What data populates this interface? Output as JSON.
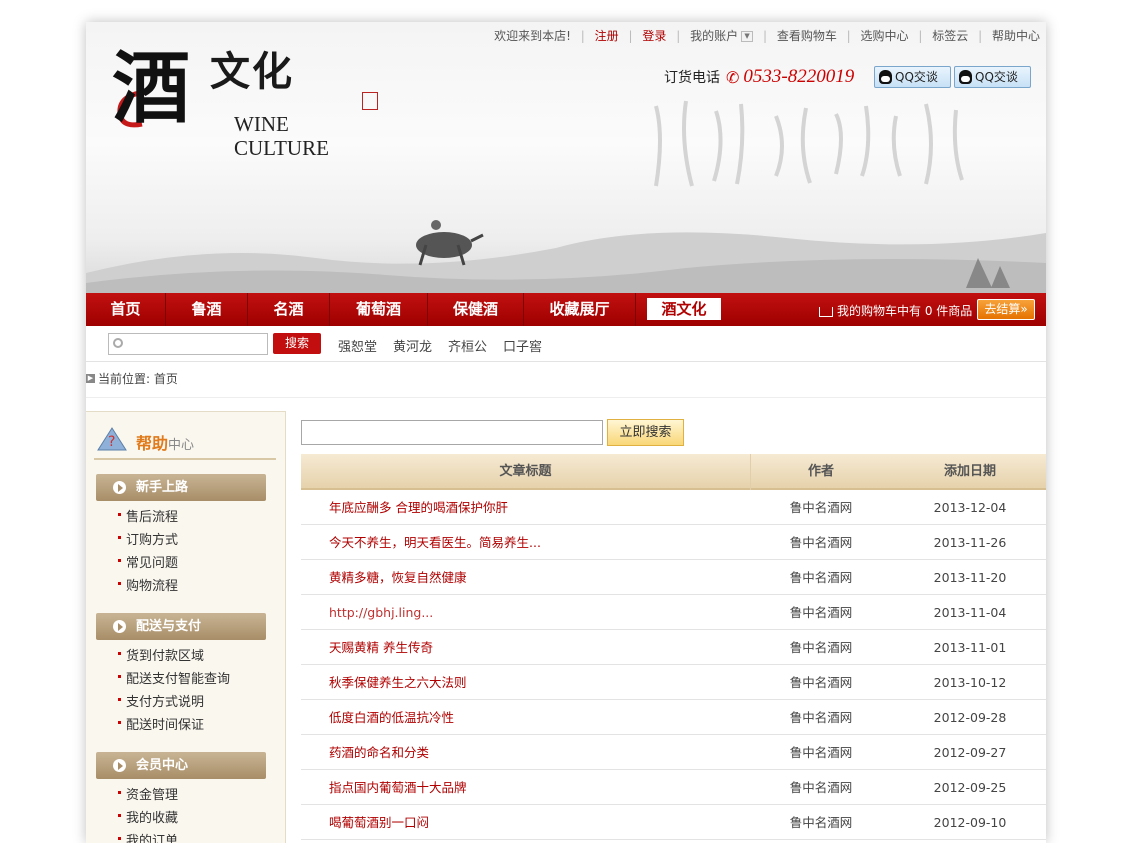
{
  "topbar": {
    "welcome": "欢迎来到本店!",
    "register": "注册",
    "login": "登录",
    "my_account": "我的账户",
    "view_cart": "查看购物车",
    "selection_center": "选购中心",
    "tag_cloud": "标签云",
    "help_center": "帮助中心"
  },
  "logo": {
    "main_char": "酒",
    "sub_chars": "文化",
    "english": "WINE CULTURE"
  },
  "phone": {
    "label": "订货电话",
    "number": "0533-8220019"
  },
  "qq_buttons": [
    "QQ交谈",
    "QQ交谈"
  ],
  "nav": {
    "items": [
      "首页",
      "鲁酒",
      "名酒",
      "葡萄酒",
      "保健酒",
      "收藏展厅",
      "酒文化"
    ],
    "active": "酒文化",
    "cart_text": "我的购物车中有 0 件商品",
    "checkout": "去结算»"
  },
  "search": {
    "button": "搜索",
    "keywords": [
      "强恕堂",
      "黄河龙",
      "齐桓公",
      "口子窖"
    ]
  },
  "breadcrumb": {
    "text": "当前位置: 首页"
  },
  "sidebar": {
    "title_main": "帮助",
    "title_sub": "中心",
    "sections": [
      {
        "title": "新手上路",
        "links": [
          "售后流程",
          "订购方式",
          "常见问题",
          "购物流程"
        ]
      },
      {
        "title": "配送与支付",
        "links": [
          "货到付款区域",
          "配送支付智能查询",
          "支付方式说明",
          "配送时间保证"
        ]
      },
      {
        "title": "会员中心",
        "links": [
          "资金管理",
          "我的收藏",
          "我的订单"
        ]
      }
    ]
  },
  "main": {
    "search_button": "立即搜索",
    "columns": [
      "文章标题",
      "作者",
      "添加日期"
    ],
    "articles": [
      {
        "title": "年底应酬多 合理的喝酒保护你肝",
        "author": "鲁中名酒网",
        "date": "2013-12-04"
      },
      {
        "title": "今天不养生，明天看医生。简易养生...",
        "author": "鲁中名酒网",
        "date": "2013-11-26"
      },
      {
        "title": "黄精多糖，恢复自然健康",
        "author": "鲁中名酒网",
        "date": "2013-11-20"
      },
      {
        "title": "http://gbhj.ling...",
        "author": "鲁中名酒网",
        "date": "2013-11-04"
      },
      {
        "title": "天赐黄精 养生传奇",
        "author": "鲁中名酒网",
        "date": "2013-11-01"
      },
      {
        "title": "秋季保健养生之六大法则",
        "author": "鲁中名酒网",
        "date": "2013-10-12"
      },
      {
        "title": "低度白酒的低温抗冷性",
        "author": "鲁中名酒网",
        "date": "2012-09-28"
      },
      {
        "title": "药酒的命名和分类",
        "author": "鲁中名酒网",
        "date": "2012-09-27"
      },
      {
        "title": "指点国内葡萄酒十大品牌",
        "author": "鲁中名酒网",
        "date": "2012-09-25"
      },
      {
        "title": "喝葡萄酒别一口闷",
        "author": "鲁中名酒网",
        "date": "2012-09-10"
      }
    ]
  },
  "colors": {
    "nav_red": "#b00000",
    "link_red": "#b00000",
    "checkout_orange": "#f08a12",
    "sidebar_tan": "#b49c76"
  },
  "icons": [
    "search-icon",
    "phone-icon",
    "qq-icon",
    "cart-icon",
    "chevron-down-icon",
    "arrow-right-icon",
    "help-icon"
  ]
}
